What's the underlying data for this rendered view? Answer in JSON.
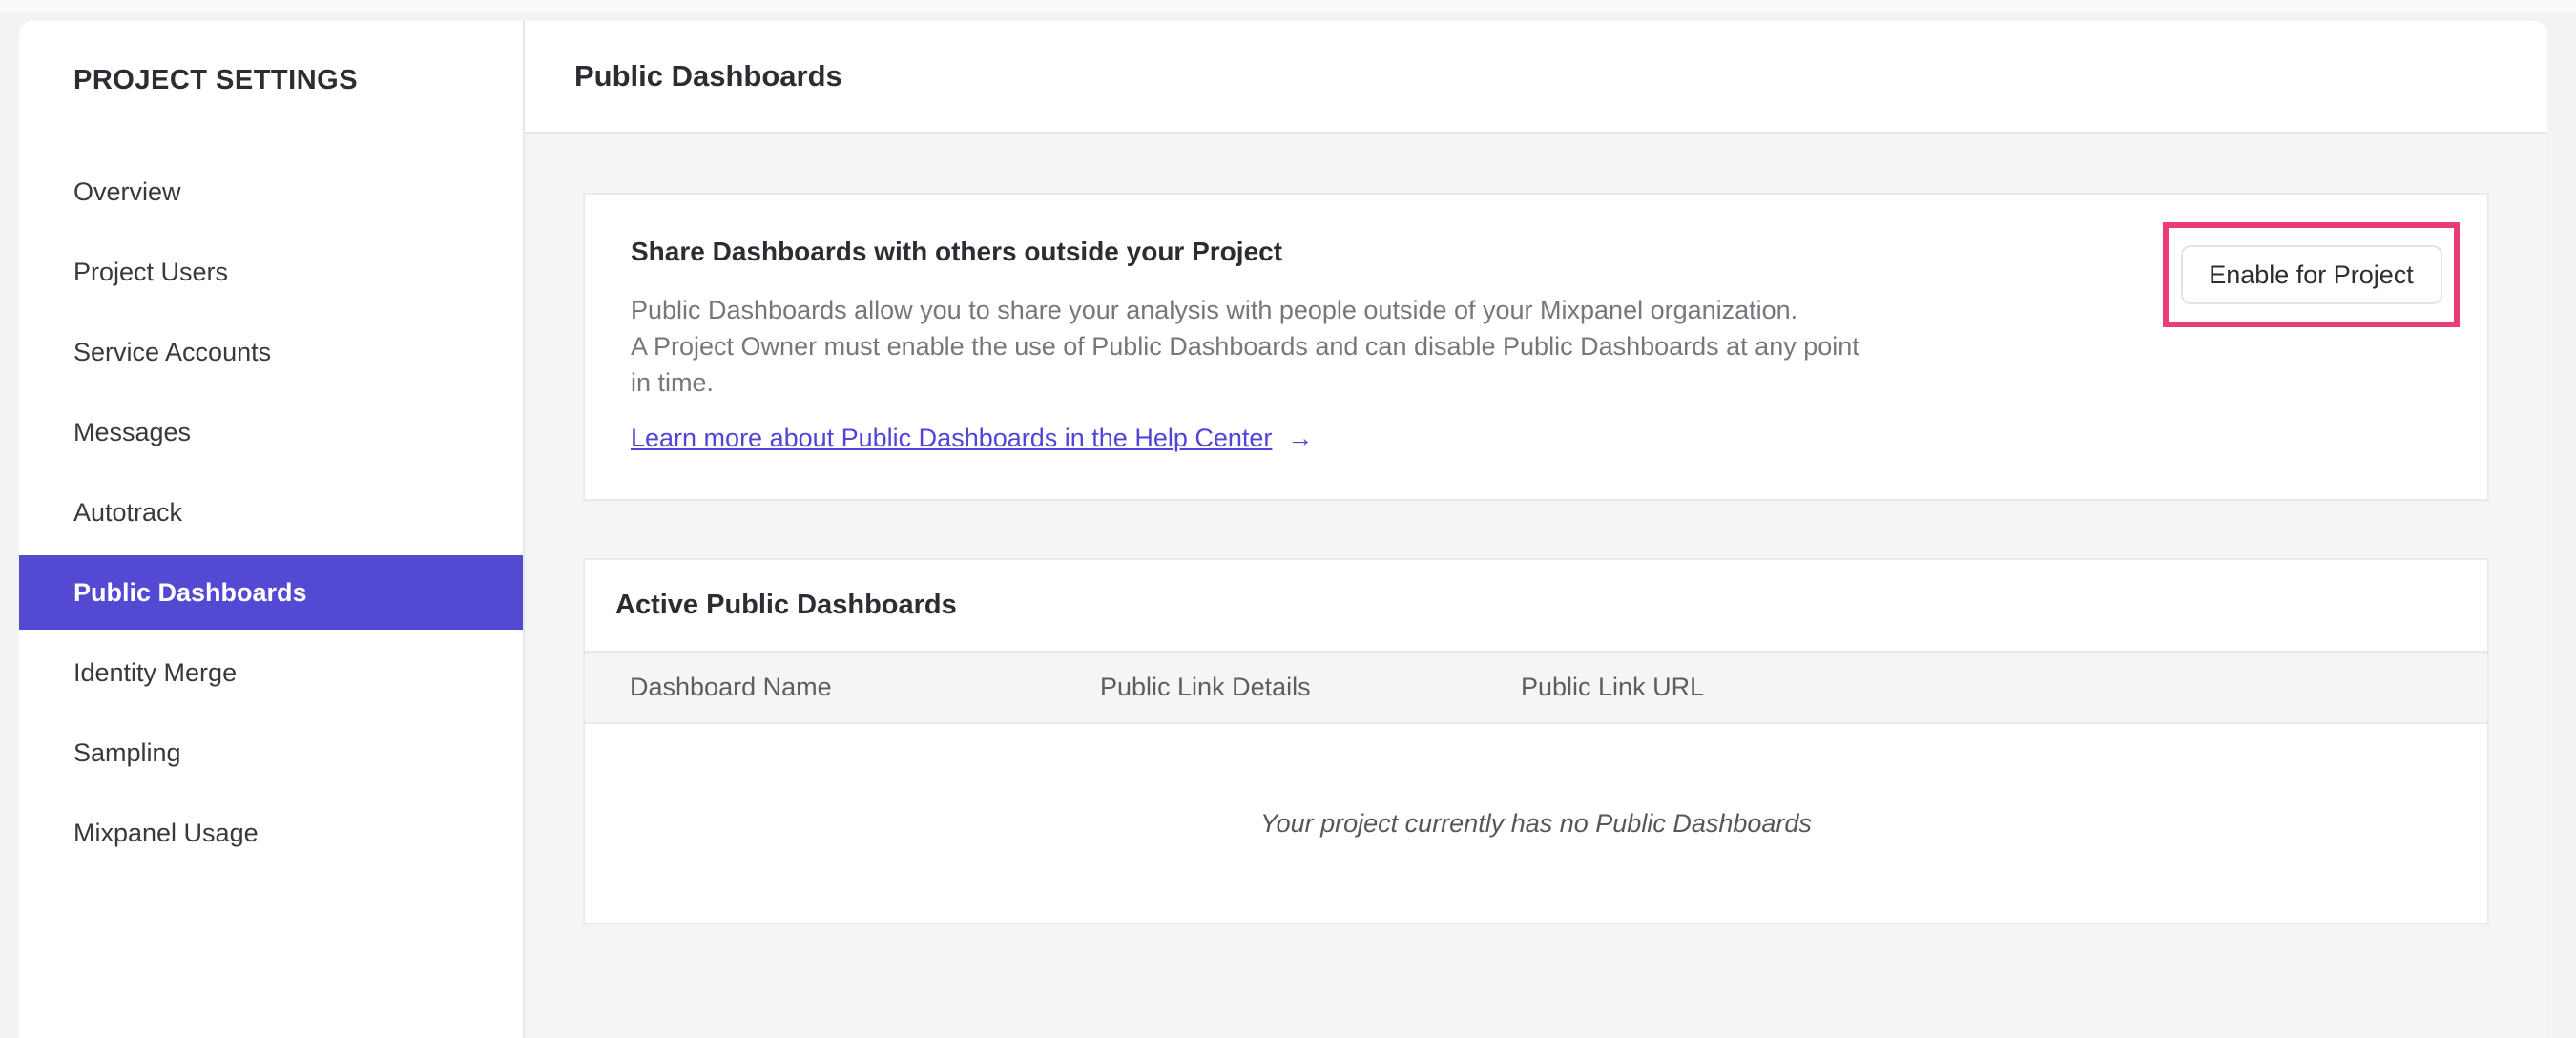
{
  "sidebar": {
    "title": "PROJECT SETTINGS",
    "items": [
      {
        "label": "Overview",
        "selected": false
      },
      {
        "label": "Project Users",
        "selected": false
      },
      {
        "label": "Service Accounts",
        "selected": false
      },
      {
        "label": "Messages",
        "selected": false
      },
      {
        "label": "Autotrack",
        "selected": false
      },
      {
        "label": "Public Dashboards",
        "selected": true
      },
      {
        "label": "Identity Merge",
        "selected": false
      },
      {
        "label": "Sampling",
        "selected": false
      },
      {
        "label": "Mixpanel Usage",
        "selected": false
      }
    ],
    "selected_color": "#5349d2"
  },
  "header": {
    "title": "Public Dashboards"
  },
  "share_card": {
    "heading": "Share Dashboards with others outside your Project",
    "body_lines": [
      "Public Dashboards allow you to share your analysis with people outside of your Mixpanel organization.",
      "A Project Owner must enable the use of Public Dashboards and can disable Public Dashboards at any point",
      "in time."
    ],
    "link_label": "Learn more about Public Dashboards in the Help Center",
    "link_arrow": "→",
    "button_label": "Enable for Project",
    "highlight_color": "#ea3d77"
  },
  "active_card": {
    "heading": "Active Public Dashboards",
    "columns": [
      "Dashboard Name",
      "Public Link Details",
      "Public Link URL"
    ],
    "empty_message": "Your project currently has no Public Dashboards"
  }
}
